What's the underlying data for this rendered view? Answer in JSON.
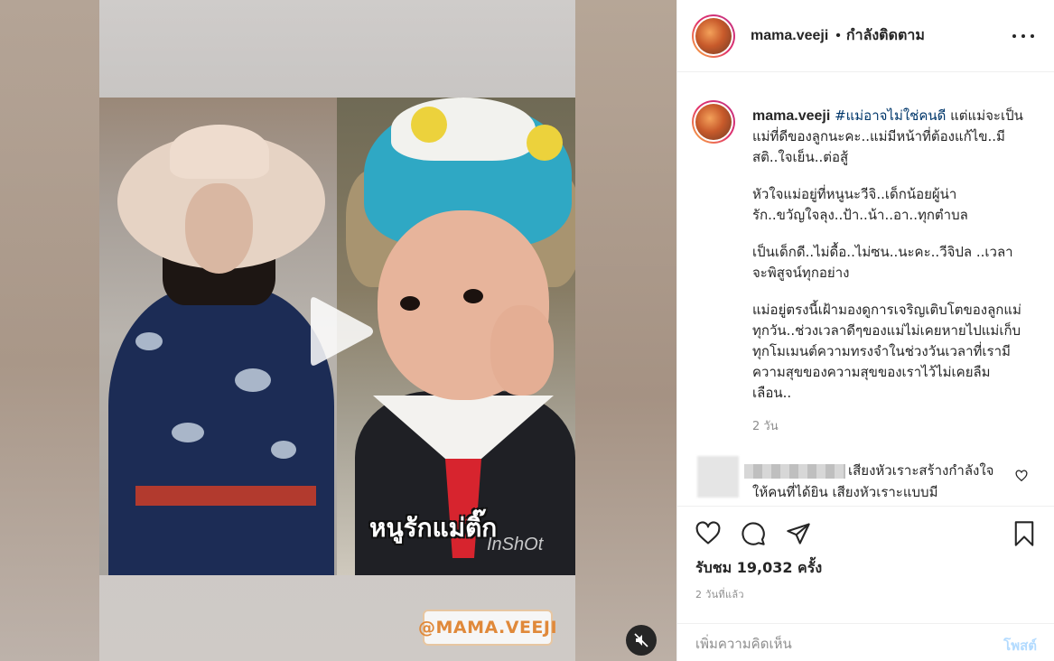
{
  "media": {
    "overlay_caption": "หนูรักแม่ติ๊ก",
    "watermark": "InShOt",
    "sticker_handle": "@MAMA.VEEJI",
    "play_icon": "play-icon",
    "mute_icon": "mute-icon"
  },
  "header": {
    "username": "mama.veeji",
    "separator": "•",
    "follow_status": "กำลังติดตาม",
    "more_icon": "more-options-icon"
  },
  "caption": {
    "username": "mama.veeji",
    "hashtag": "#แม่อาจไม่ใช่คนดี",
    "first_line_rest": " แต่แม่จะเป็นแม่ที่ดีของลูกนะคะ..แม่มีหน้าที่ต้องแก้ไข..มีสติ..ใจเย็น..ต่อสู้",
    "paragraph2": "หัวใจแม่อยู่ที่หนูนะวีจิ..เด็กน้อยผู้น่ารัก..ขวัญใจลุง..ป้า..น้า..อา..ทุกตำบล",
    "paragraph3": "เป็นเด็กดี..ไม่ดื้อ..ไม่ซน..นะคะ..วีจิปล ..เวลาจะพิสูจน์ทุกอย่าง",
    "paragraph4": "แม่อยู่ตรงนี้เฝ้ามองดูการเจริญเติบโตของลูกแม่ทุกวัน..ช่วงเวลาดีๆของแม่ไม่เคยหายไปแม่เก็บทุกโมเมนต์ความทรงจำในช่วงวันเวลาที่เรามีความสุขของความสุขของเราไว้ไม่เคยลืมเลือน..",
    "time": "2 วัน"
  },
  "comment": {
    "text": "เสียงหัวเราะสร้างกำลังใจให้คนที่ได้ยิน เสียงหัวเราะแบบมี"
  },
  "actions": {
    "like_icon": "heart-icon",
    "comment_icon": "comment-icon",
    "share_icon": "share-icon",
    "save_icon": "bookmark-icon",
    "views": "รับชม 19,032 ครั้ง",
    "date": "2 วันที่แล้ว"
  },
  "add_comment": {
    "placeholder": "เพิ่มความคิดเห็น",
    "post_label": "โพสต์"
  },
  "colors": {
    "link": "#00376b",
    "post_disabled": "#b3dbff",
    "muted": "#8e8e8e",
    "sticker_text": "#e0893a"
  }
}
